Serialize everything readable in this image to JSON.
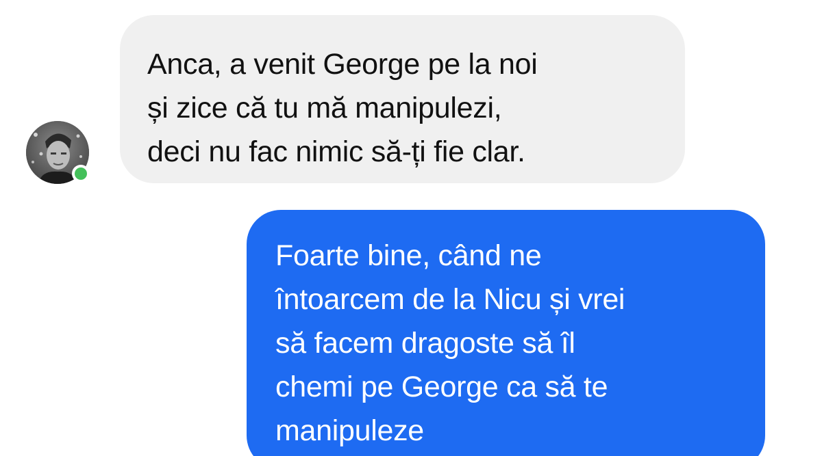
{
  "conversation": {
    "contact": {
      "avatar_icon": "user-avatar-icon",
      "online": true,
      "presence_color": "#44c05a"
    },
    "messages": [
      {
        "direction": "received",
        "text": "Anca, a venit George pe la noi\nși zice că tu mă manipulezi,\ndeci nu fac nimic să-ți fie clar.",
        "bubble_color": "#f0f0f0"
      },
      {
        "direction": "sent",
        "text": "Foarte bine, când ne\nîntoarcem de la Nicu și vrei\nsă facem dragoste să îl\nchemi pe George ca să te\nmanipuleze",
        "bubble_color": "#1e6bf2"
      }
    ]
  }
}
